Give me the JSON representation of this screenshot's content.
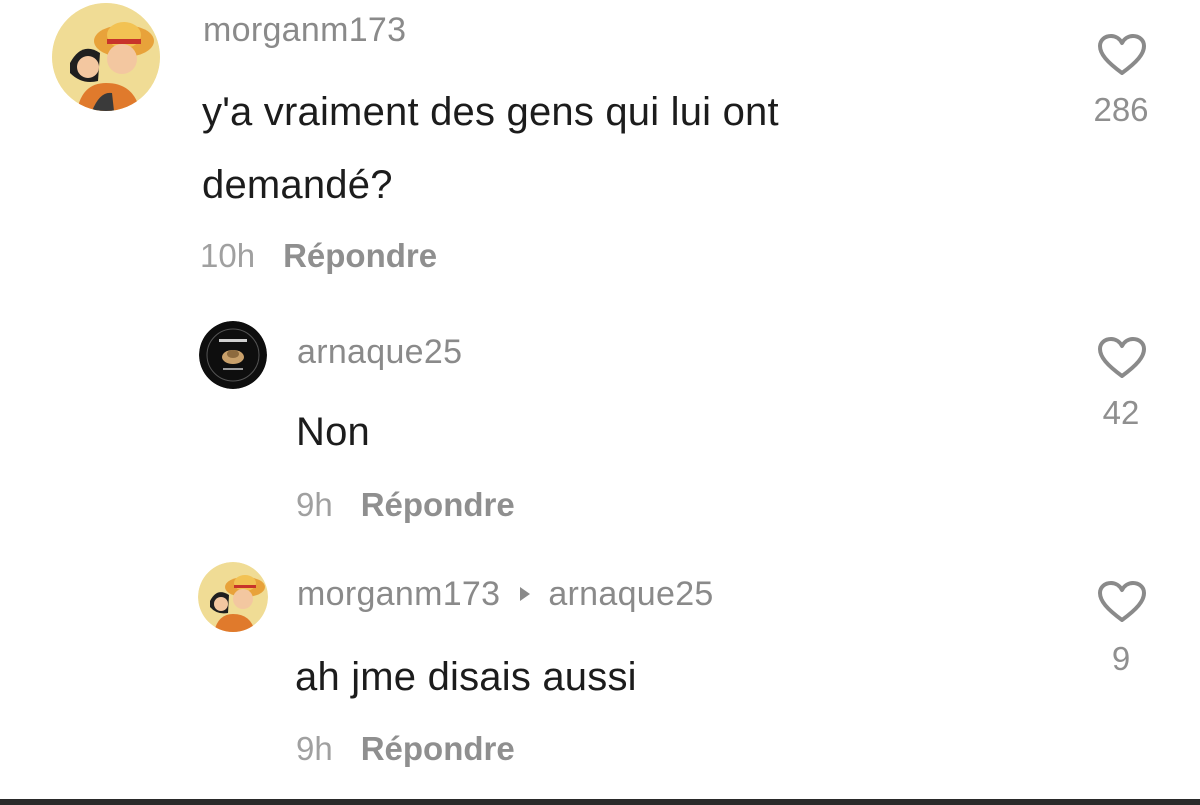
{
  "comments": [
    {
      "username": "morganm173",
      "text_line1": "y'a vraiment des gens qui lui ont",
      "text_line2": "demandé?",
      "time": "10h",
      "reply_label": "Répondre",
      "likes": "286",
      "avatar_icon": "anime-character-avatar"
    },
    {
      "username": "arnaque25",
      "text": "Non",
      "time": "9h",
      "reply_label": "Répondre",
      "likes": "42",
      "avatar_icon": "dark-logo-avatar"
    },
    {
      "username": "morganm173",
      "reply_to": "arnaque25",
      "text": "ah jme disais aussi",
      "time": "9h",
      "reply_label": "Répondre",
      "likes": "9",
      "avatar_icon": "anime-character-avatar"
    }
  ],
  "colors": {
    "username": "#8a8a8a",
    "text": "#1c1c1c",
    "meta": "#8f8f8f",
    "icon": "#8a8a8a"
  }
}
